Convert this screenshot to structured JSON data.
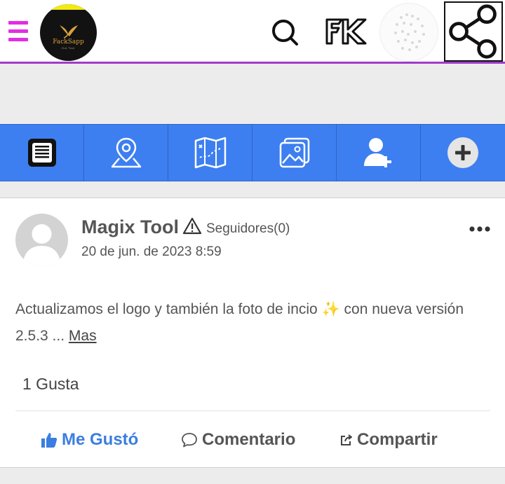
{
  "header": {
    "logo": {
      "name": "FackSapp",
      "tagline": "Dot Tool"
    },
    "icons": [
      "menu-icon",
      "search-icon",
      "fk-logo-icon",
      "profile-avatar",
      "share-icon"
    ]
  },
  "nav": {
    "items": [
      {
        "name": "feed",
        "icon": "news-feed-icon"
      },
      {
        "name": "location",
        "icon": "map-pin-icon"
      },
      {
        "name": "map",
        "icon": "folded-map-icon"
      },
      {
        "name": "photos",
        "icon": "photo-gallery-icon"
      },
      {
        "name": "add-friend",
        "icon": "add-user-icon"
      },
      {
        "name": "more",
        "icon": "plus-circle-icon"
      }
    ]
  },
  "post": {
    "author": "Magix Tool",
    "followers_label": "Seguidores(0)",
    "date": "20 de jun. de 2023 8:59",
    "text": "Actualizamos el logo y también la foto de incio ✨ con nueva versión 2.5.3 ... ",
    "more_label": "Mas",
    "likes_count": "1 Gusta",
    "actions": {
      "like": "Me Gustó",
      "comment": "Comentario",
      "share": "Compartir"
    }
  },
  "colors": {
    "accent": "#3d7ff0",
    "menu": "#e12ee6",
    "header_border": "#a13bc9",
    "liked": "#3b7ee0"
  }
}
